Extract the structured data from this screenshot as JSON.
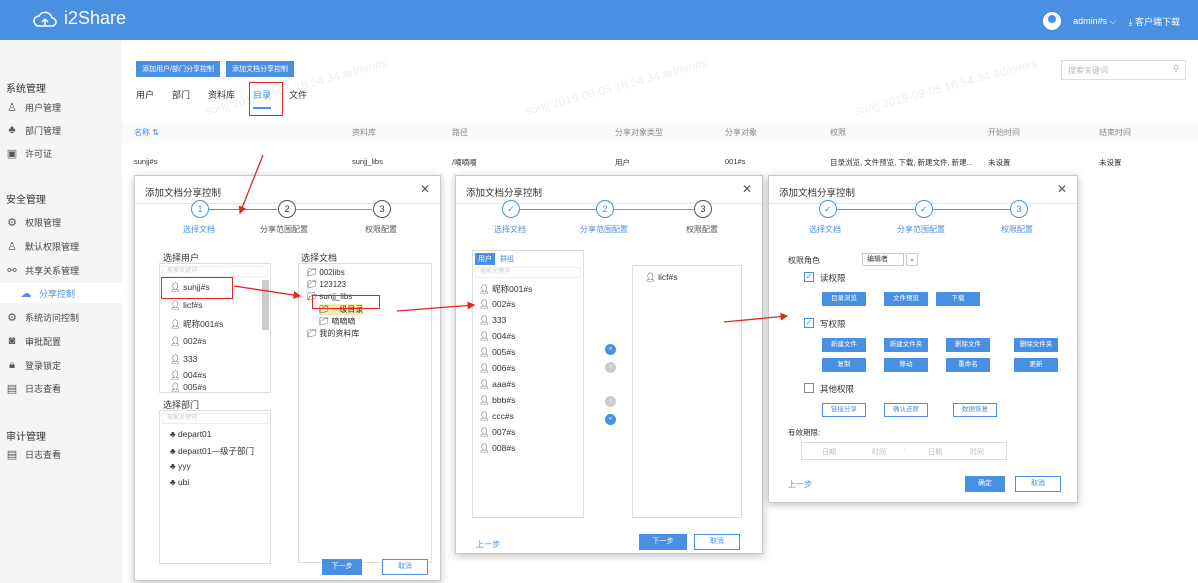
{
  "header": {
    "app_name": "i2Share",
    "username": "admin#s",
    "download_label": "客户端下载"
  },
  "sidebar": {
    "groups": [
      {
        "title": "系统管理"
      },
      {
        "title": "安全管理"
      },
      {
        "title": "审计管理"
      }
    ],
    "items": [
      {
        "label": "用户管理",
        "icon": "user-icon"
      },
      {
        "label": "部门管理",
        "icon": "org-icon"
      },
      {
        "label": "许可证",
        "icon": "license-icon"
      },
      {
        "label": "权限管理",
        "icon": "shield-icon"
      },
      {
        "label": "默认权限管理",
        "icon": "users-icon"
      },
      {
        "label": "共享关系管理",
        "icon": "share-icon"
      },
      {
        "label": "分享控制",
        "icon": "cloud-icon"
      },
      {
        "label": "系统访问控制",
        "icon": "access-icon"
      },
      {
        "label": "审批配置",
        "icon": "approval-icon"
      },
      {
        "label": "登录锁定",
        "icon": "lock-icon"
      },
      {
        "label": "日志查看",
        "icon": "log-icon"
      },
      {
        "label": "日志查看",
        "icon": "log-icon"
      }
    ]
  },
  "main": {
    "buttons": {
      "add_user_dept": "添加用户/部门分享控制",
      "add_doc": "添加文档分享控制"
    },
    "tabs": [
      "用户",
      "部门",
      "资料库",
      "目录",
      "文件"
    ],
    "search_placeholder": "搜索关键词",
    "table": {
      "headers": [
        "名称 ⇅",
        "资料库",
        "路径",
        "分享对象类型",
        "分享对象",
        "权限",
        "开始时间",
        "结束时间"
      ],
      "rows": [
        [
          "sunjj#s",
          "sunjj_libs",
          "/嘀嘀嘀",
          "用户",
          "001#s",
          "目录浏览, 文件预览, 下载, 新建文件, 新建...",
          "未设置",
          "未设置"
        ]
      ]
    },
    "watermark": "sunjj 2019-09-05 16:54:34 admin#s"
  },
  "dialog1": {
    "title": "添加文档分享控制",
    "steps": [
      "选择文档",
      "分享范围配置",
      "权限配置"
    ],
    "step_nums": [
      "1",
      "2",
      "3"
    ],
    "select_user_label": "选择用户",
    "select_doc_label": "选择文档",
    "select_dept_label": "选择部门",
    "search_placeholder": "搜索关键词",
    "users": [
      "sunjj#s",
      "licf#s",
      "昵称001#s",
      "002#s",
      "333",
      "004#s",
      "005#s"
    ],
    "docs": [
      "002libs",
      "123123",
      "sunjj_libs",
      "一级目录",
      "嘀嘀嘀",
      "我的资料库"
    ],
    "depts": [
      "depart01",
      "depart01—级子部门",
      "yyy",
      "ubi"
    ],
    "next": "下一步",
    "cancel": "取消"
  },
  "dialog2": {
    "title": "添加文档分享控制",
    "steps": [
      "选择文档",
      "分享范围配置",
      "权限配置"
    ],
    "step_nums": [
      "✓",
      "2",
      "3"
    ],
    "tab_user": "用户",
    "tab_group": "群组",
    "search_placeholder": "搜索关键词",
    "left_list": [
      "昵称001#s",
      "002#s",
      "333",
      "004#s",
      "005#s",
      "006#s",
      "aaa#s",
      "bbb#s",
      "ccc#s",
      "007#s",
      "008#s"
    ],
    "right_list": [
      "licf#s"
    ],
    "prev": "上一步",
    "next": "下一步",
    "cancel": "取消"
  },
  "dialog3": {
    "title": "添加文档分享控制",
    "steps": [
      "选择文档",
      "分享范围配置",
      "权限配置"
    ],
    "step_nums": [
      "✓",
      "✓",
      "3"
    ],
    "role_label": "权限角色",
    "role_value": "编辑者",
    "read_label": "读权限",
    "read_buttons": [
      "目录浏览",
      "文件预览",
      "下载"
    ],
    "write_label": "写权限",
    "write_buttons": [
      "新建文件",
      "新建文件夹",
      "删除文件",
      "删除文件夹",
      "复制",
      "移动",
      "重命名",
      "更新"
    ],
    "other_label": "其他权限",
    "other_buttons": [
      "链接分享",
      "确认还原",
      "数据恢复"
    ],
    "valid_label": "有效期限:",
    "date_ph": "日期",
    "time_ph": "时间",
    "prev": "上一步",
    "ok": "确定",
    "cancel": "取消"
  }
}
